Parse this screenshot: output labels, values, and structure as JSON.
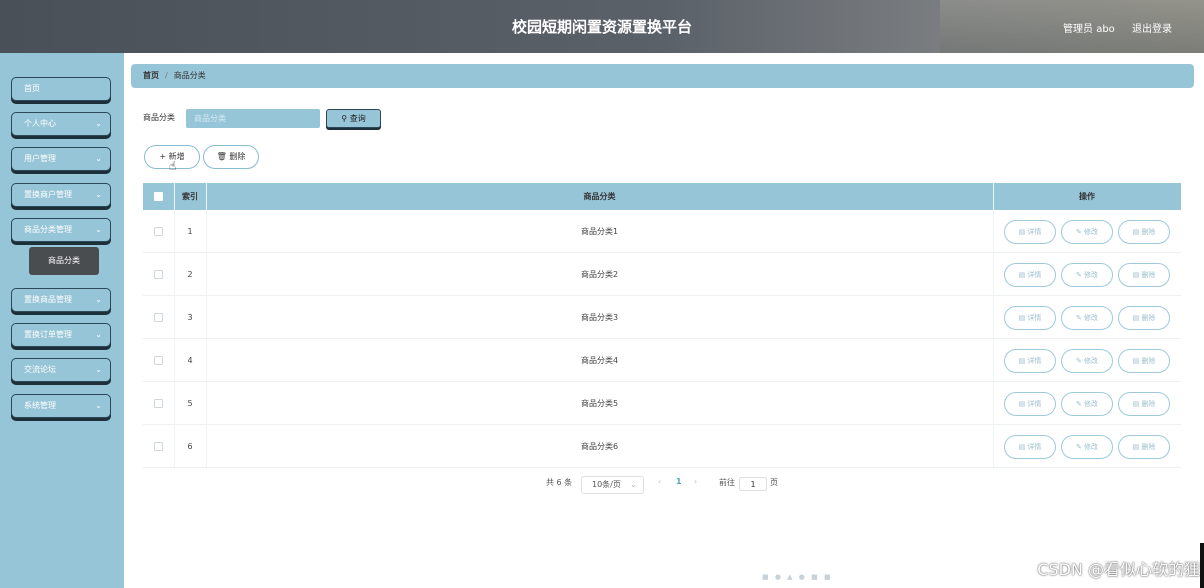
{
  "header": {
    "title": "校园短期闲置资源置换平台",
    "user": "管理员 abo",
    "logout": "退出登录"
  },
  "sidebar": {
    "items": [
      {
        "label": "首页",
        "expandable": false
      },
      {
        "label": "个人中心",
        "expandable": true
      },
      {
        "label": "用户管理",
        "expandable": true
      },
      {
        "label": "置换商户管理",
        "expandable": true
      },
      {
        "label": "商品分类管理",
        "expandable": true
      },
      {
        "label": "置换商品管理",
        "expandable": true
      },
      {
        "label": "置换订单管理",
        "expandable": true
      },
      {
        "label": "交流论坛",
        "expandable": true
      },
      {
        "label": "系统管理",
        "expandable": true
      }
    ],
    "active_submenu": "商品分类"
  },
  "breadcrumb": {
    "home": "首页",
    "current": "商品分类"
  },
  "search": {
    "label": "商品分类",
    "placeholder": "商品分类",
    "query_button": "查询"
  },
  "actions": {
    "add": "新增",
    "delete": "删除"
  },
  "table": {
    "headers": {
      "index": "索引",
      "category": "商品分类",
      "operations": "操作"
    },
    "row_buttons": {
      "detail": "详情",
      "edit": "修改",
      "delete": "删除"
    },
    "rows": [
      {
        "index": "1",
        "category": "商品分类1"
      },
      {
        "index": "2",
        "category": "商品分类2"
      },
      {
        "index": "3",
        "category": "商品分类3"
      },
      {
        "index": "4",
        "category": "商品分类4"
      },
      {
        "index": "5",
        "category": "商品分类5"
      },
      {
        "index": "6",
        "category": "商品分类6"
      }
    ]
  },
  "pagination": {
    "total": "共 6 条",
    "page_size": "10条/页",
    "current_page": "1",
    "goto_label": "前往",
    "goto_value": "1",
    "page_unit": "页"
  },
  "watermark": "CSDN @看似心软的狸",
  "colors": {
    "accent": "#97c5d8",
    "header_bg": "#5b6169",
    "border_dark": "#2b4858"
  }
}
